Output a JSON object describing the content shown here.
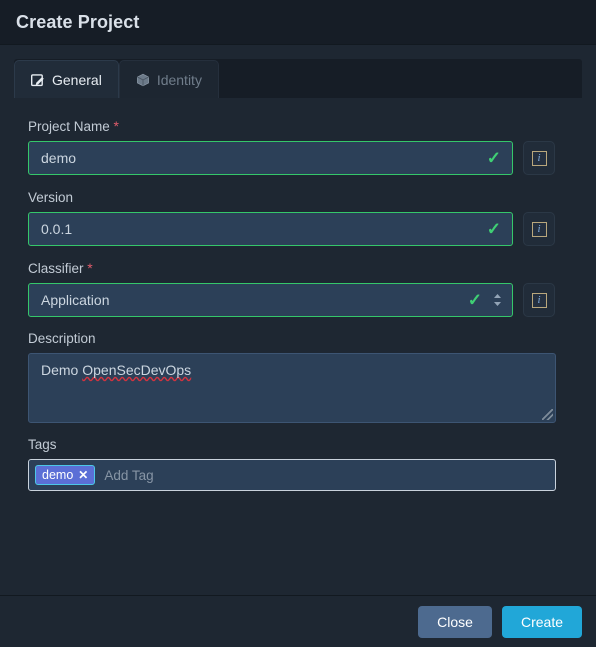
{
  "dialog": {
    "title": "Create Project"
  },
  "tabs": [
    {
      "label": "General",
      "icon": "edit-square-icon",
      "active": true
    },
    {
      "label": "Identity",
      "icon": "cube-icon",
      "active": false
    }
  ],
  "form": {
    "project_name": {
      "label": "Project Name",
      "required_marker": "*",
      "value": "demo",
      "placeholder": "",
      "valid_icon": "✓",
      "info_icon": "i"
    },
    "version": {
      "label": "Version",
      "required_marker": "",
      "value": "0.0.1",
      "placeholder": "",
      "valid_icon": "✓",
      "info_icon": "i"
    },
    "classifier": {
      "label": "Classifier",
      "required_marker": "*",
      "value": "Application",
      "placeholder": "",
      "valid_icon": "✓",
      "spinner_up": "▲",
      "spinner_down": "▼",
      "info_icon": "i"
    },
    "description": {
      "label": "Description",
      "value_plain": "Demo ",
      "value_misspelled": "OpenSecDevOps"
    },
    "tags": {
      "label": "Tags",
      "chips": [
        {
          "label": "demo",
          "remove_icon": "✕"
        }
      ],
      "placeholder": "Add Tag"
    }
  },
  "footer": {
    "close_label": "Close",
    "create_label": "Create"
  },
  "colors": {
    "accent_create": "#21a7d8",
    "close_button": "#4d6a8f",
    "valid_border": "#35c76a",
    "required_marker": "#e05c6b",
    "tag_chip_bg": "#5b6fd6",
    "tag_chip_border": "#4cc7e8",
    "header_bg": "#161d26",
    "body_bg": "#1e2732",
    "input_bg": "#2c4058"
  }
}
